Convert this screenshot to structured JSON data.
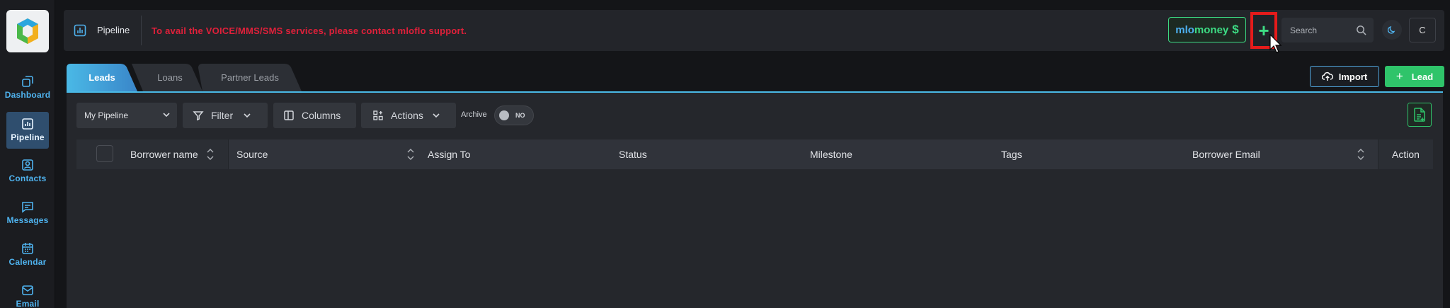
{
  "sidebar": {
    "logo_alt": "logo",
    "items": [
      {
        "label": "Dashboard",
        "icon": "dashboard-icon"
      },
      {
        "label": "Pipeline",
        "icon": "pipeline-icon",
        "active": true
      },
      {
        "label": "Contacts",
        "icon": "contacts-icon"
      },
      {
        "label": "Messages",
        "icon": "messages-icon"
      },
      {
        "label": "Calendar",
        "icon": "calendar-icon"
      },
      {
        "label": "Email",
        "icon": "email-icon"
      }
    ]
  },
  "header": {
    "title": "Pipeline",
    "notice": "To avail the VOICE/MMS/SMS services, please contact mloflo support.",
    "money_mlo": "mlo",
    "money_money": "money",
    "money_symbol": "$",
    "add_label": "+",
    "search_placeholder": "Search",
    "user_initial": "C"
  },
  "tabs": [
    {
      "label": "Leads",
      "active": true
    },
    {
      "label": "Loans",
      "active": false
    },
    {
      "label": "Partner Leads",
      "active": false
    }
  ],
  "actions": {
    "import_label": "Import",
    "lead_label": "Lead",
    "lead_plus": "+"
  },
  "toolbar": {
    "pipeline_value": "My Pipeline",
    "filter_label": "Filter",
    "columns_label": "Columns",
    "actions_label": "Actions",
    "archive_label": "Archive",
    "archive_state": "NO"
  },
  "table": {
    "columns": [
      "Borrower name",
      "Source",
      "Assign To",
      "Status",
      "Milestone",
      "Tags",
      "Borrower Email",
      "Action"
    ]
  },
  "colors": {
    "accent": "#4ab9e6",
    "success": "#2fc46a",
    "alert": "#e0203a"
  }
}
